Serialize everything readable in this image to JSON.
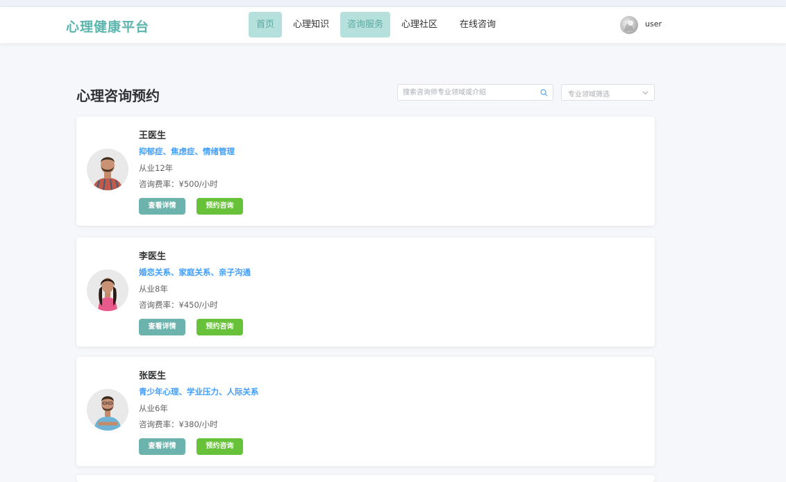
{
  "header": {
    "logo": "心理健康平台",
    "nav": [
      {
        "label": "首页",
        "active": true
      },
      {
        "label": "心理知识",
        "active": false
      },
      {
        "label": "咨询服务",
        "active": true
      },
      {
        "label": "心理社区",
        "active": false
      },
      {
        "label": "在线咨询",
        "active": false
      }
    ],
    "username": "user"
  },
  "main": {
    "title": "心理咨询预约",
    "search": {
      "placeholder": "搜索咨询师专业领域或介绍",
      "icon": "search-icon"
    },
    "filter": {
      "placeholder": "专业领域筛选",
      "icon": "chevron-down-icon"
    },
    "doctors": [
      {
        "name": "王医生",
        "specialties": "抑郁症、焦虑症、情绪管理",
        "years": "从业12年",
        "rate": "咨询费率：¥500/小时",
        "detail_label": "查看详情",
        "book_label": "预约咨询"
      },
      {
        "name": "李医生",
        "specialties": "婚恋关系、家庭关系、亲子沟通",
        "years": "从业8年",
        "rate": "咨询费率：¥450/小时",
        "detail_label": "查看详情",
        "book_label": "预约咨询"
      },
      {
        "name": "张医生",
        "specialties": "青少年心理、学业压力、人际关系",
        "years": "从业6年",
        "rate": "咨询费率：¥380/小时",
        "detail_label": "查看详情",
        "book_label": "预约咨询"
      }
    ]
  },
  "colors": {
    "brand": "#5bb5ad",
    "nav_active_bg": "#b5e0dc",
    "link_blue": "#409eff",
    "detail_button": "#6db3ad",
    "book_button": "#67c23a"
  }
}
